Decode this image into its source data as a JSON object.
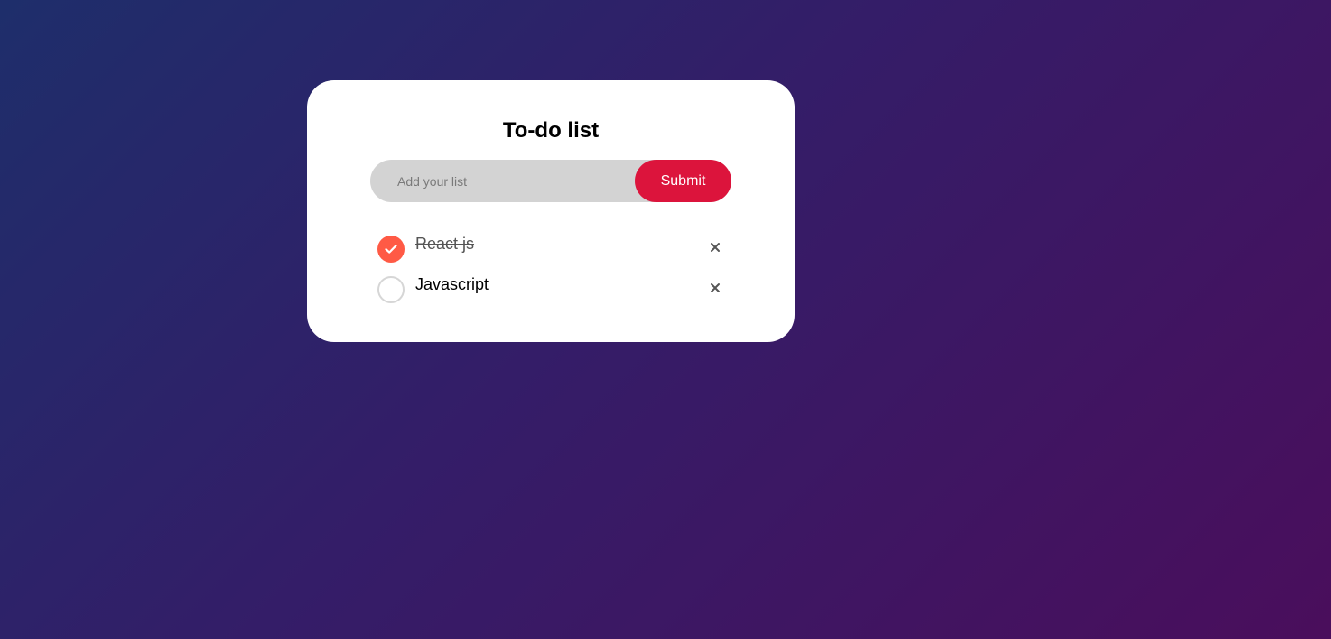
{
  "app": {
    "title": "To-do list"
  },
  "input": {
    "placeholder": "Add your list",
    "value": ""
  },
  "submit_button": {
    "label": "Submit"
  },
  "todos": [
    {
      "text": "React js",
      "completed": true
    },
    {
      "text": "Javascript",
      "completed": false
    }
  ],
  "icons": {
    "checked": "check-icon",
    "unchecked": "empty-circle-icon",
    "delete": "close-icon"
  },
  "colors": {
    "background_start": "#1e2e6b",
    "background_end": "#4a0e5c",
    "card": "#ffffff",
    "input_bg": "#d3d3d3",
    "submit_bg": "#dc143c",
    "checked": "#ff5a45",
    "unchecked_border": "#d6d6d6",
    "delete_icon": "#555555"
  }
}
